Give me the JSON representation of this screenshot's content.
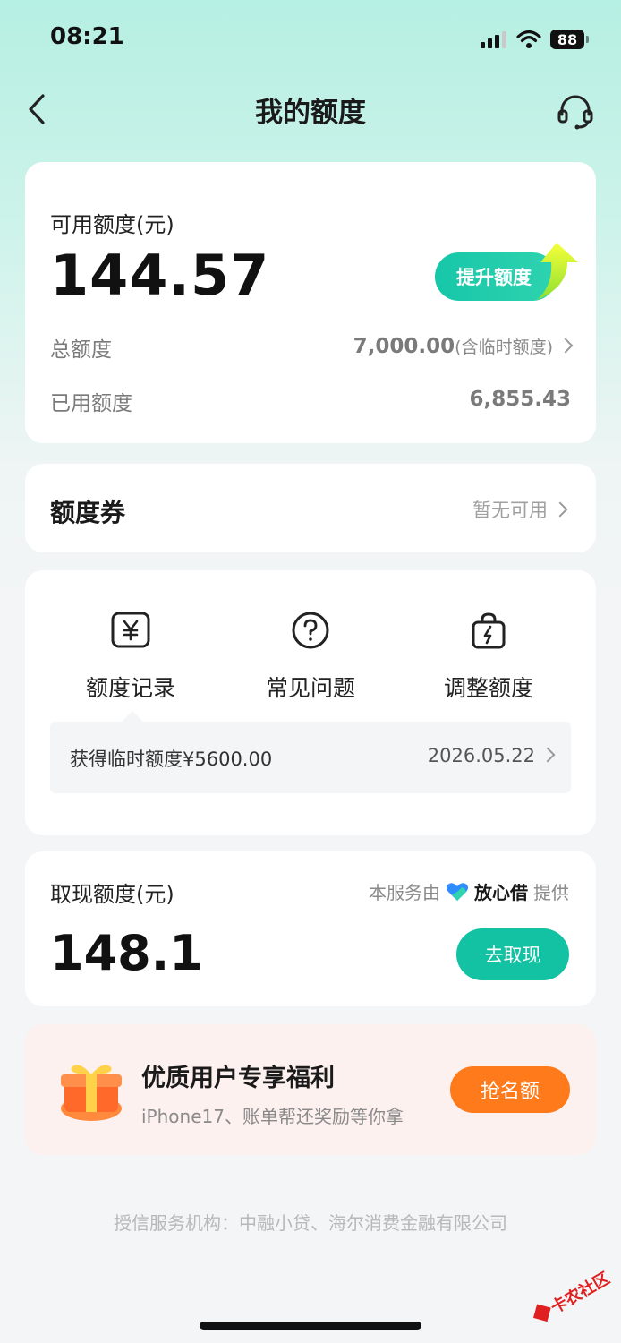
{
  "status_bar": {
    "time": "08:21",
    "battery": "88"
  },
  "header": {
    "title": "我的额度"
  },
  "credit_card": {
    "available_label": "可用额度(元)",
    "available_amount": "144.57",
    "raise_button": "提升额度",
    "total_label": "总额度",
    "total_value": "7,000.00",
    "total_note": "(含临时额度)",
    "used_label": "已用额度",
    "used_value": "6,855.43"
  },
  "coupon": {
    "title": "额度券",
    "status": "暂无可用"
  },
  "functions": {
    "items": [
      {
        "label": "额度记录",
        "icon": "yen-icon"
      },
      {
        "label": "常见问题",
        "icon": "question-icon"
      },
      {
        "label": "调整额度",
        "icon": "bolt-bag-icon"
      }
    ],
    "record_text": "获得临时额度¥5600.00",
    "record_date": "2026.05.22"
  },
  "cash": {
    "label": "取现额度(元)",
    "provider_prefix": "本服务由",
    "provider_brand": "放心借",
    "provider_suffix": "提供",
    "amount": "148.1",
    "button": "去取现"
  },
  "promo": {
    "title": "优质用户专享福利",
    "subtitle": "iPhone17、账单帮还奖励等你拿",
    "button": "抢名额"
  },
  "footer": {
    "text": "授信服务机构：中融小贷、海尔消费金融有限公司"
  },
  "watermark": {
    "text": "卡农社区"
  },
  "colors": {
    "accent": "#13c2a3",
    "promo": "#ff7a1a"
  }
}
